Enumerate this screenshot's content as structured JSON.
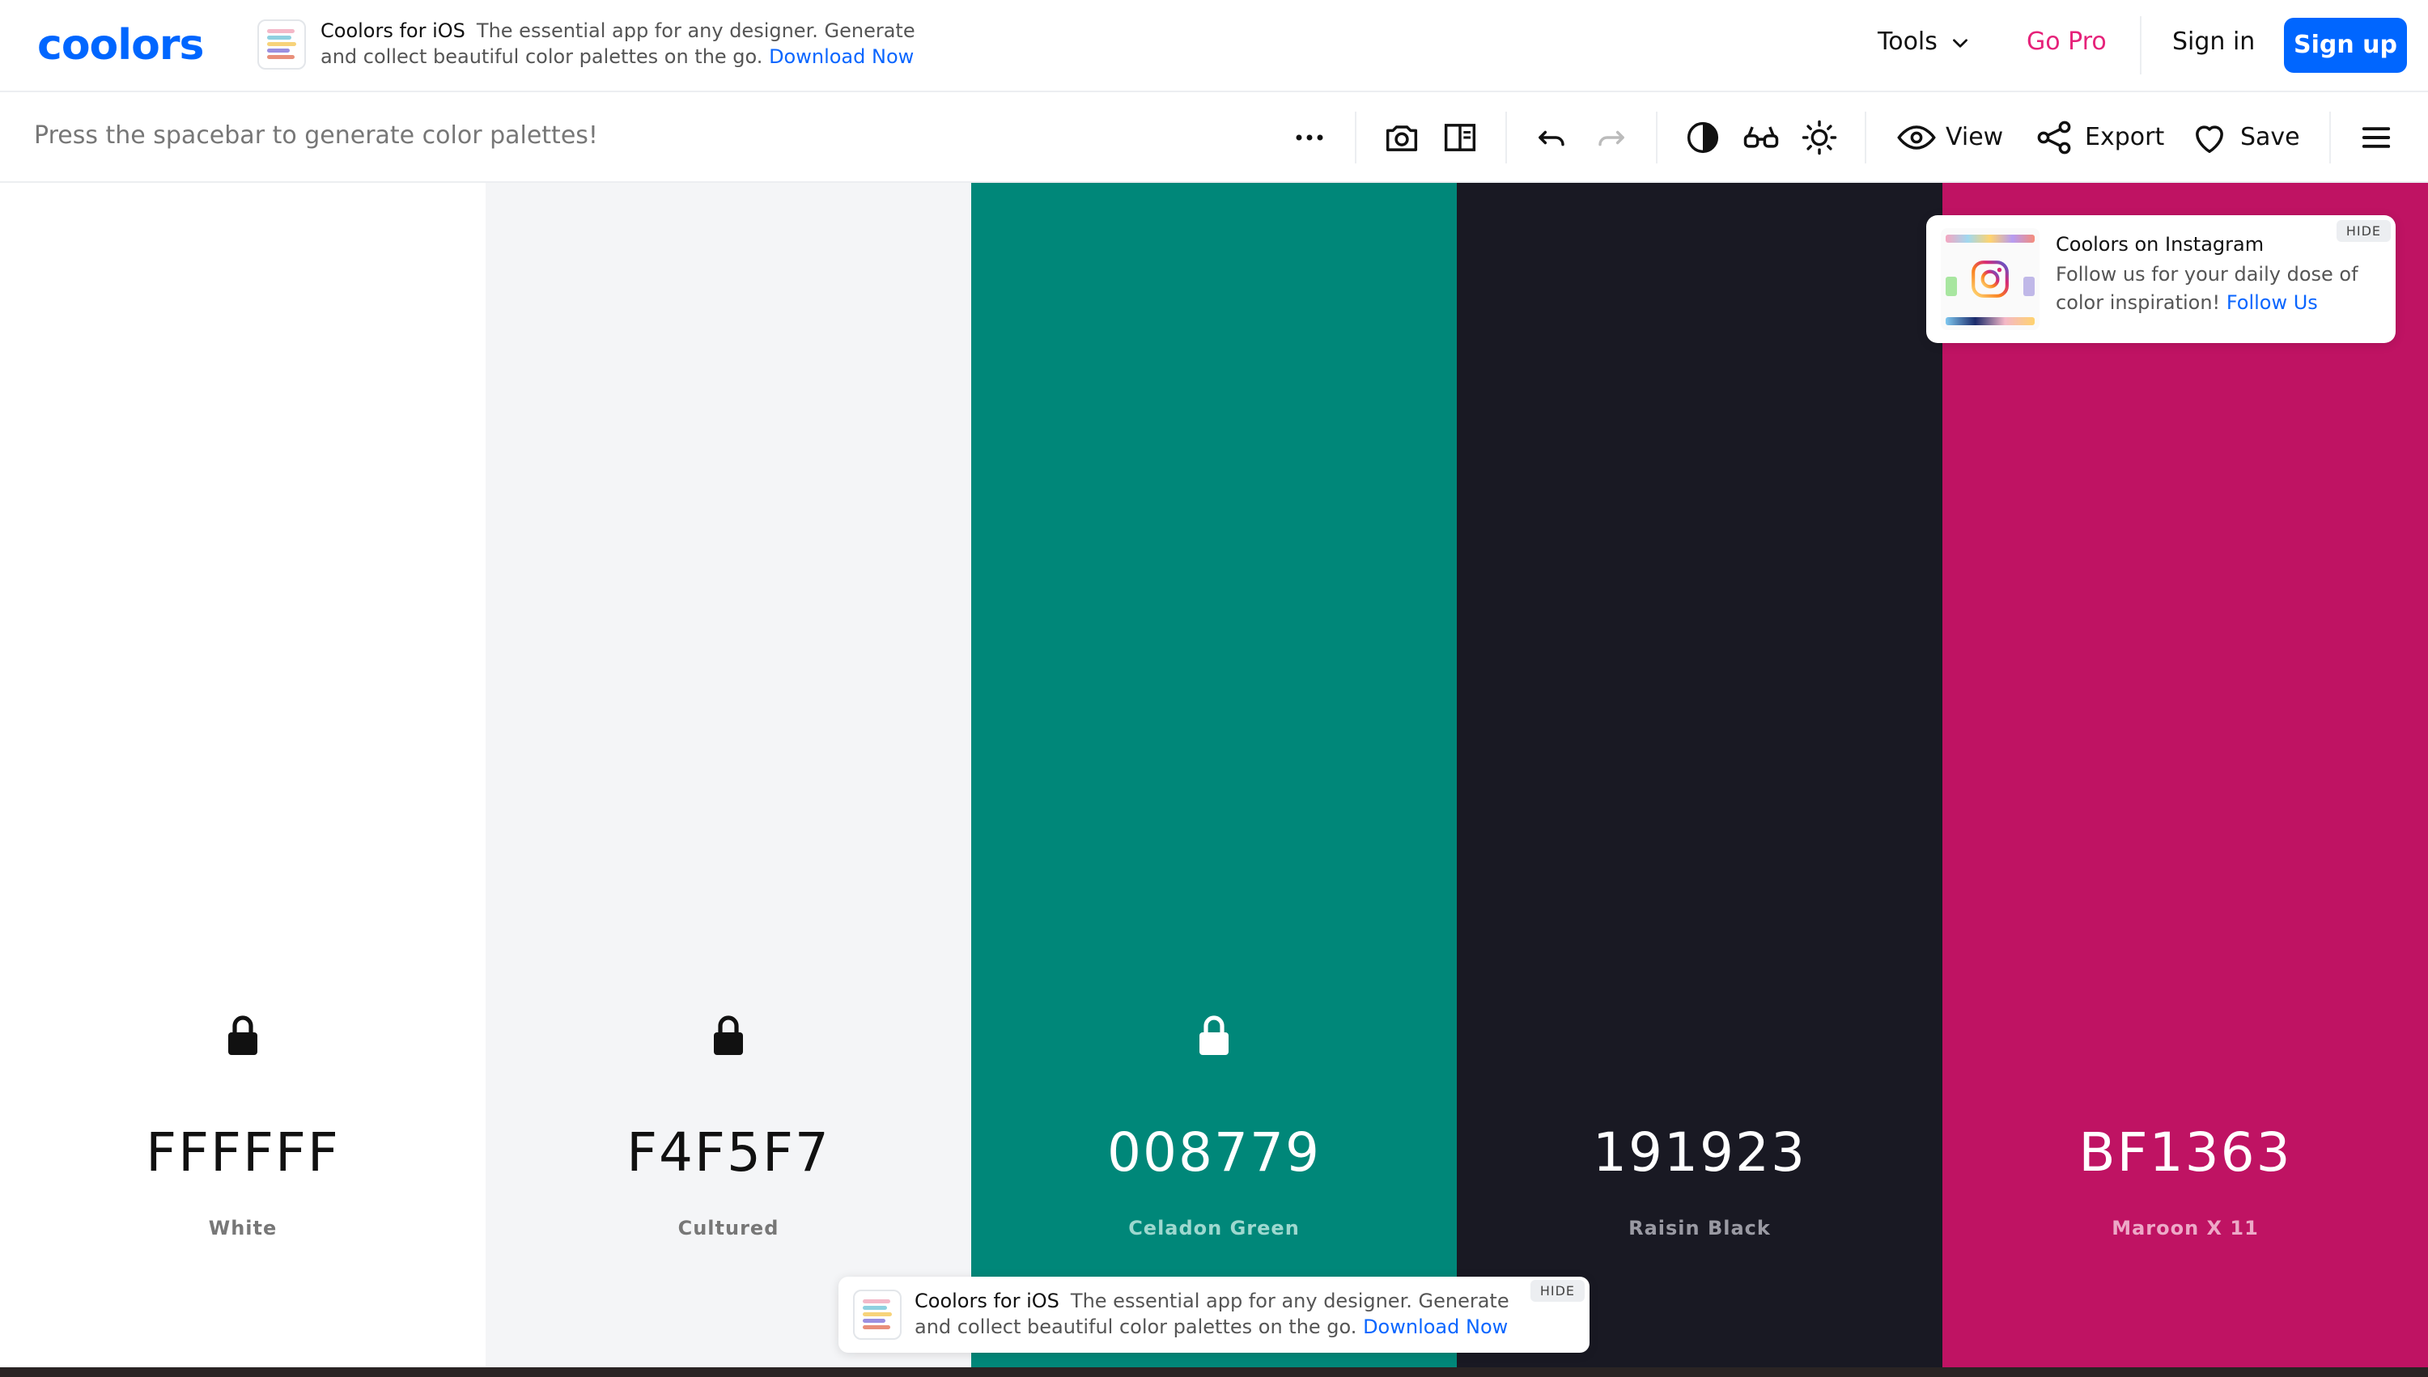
{
  "header": {
    "logo": "coolors",
    "promo": {
      "title": "Coolors for iOS",
      "text": "The essential app for any designer. Generate and collect beautiful color palettes on the go.",
      "link": "Download Now"
    },
    "nav": {
      "tools": "Tools",
      "go_pro": "Go Pro",
      "sign_in": "Sign in",
      "sign_up": "Sign up"
    }
  },
  "toolbar": {
    "hint": "Press the spacebar to generate color palettes!",
    "icons": [
      "more-icon",
      "camera-icon",
      "sidebar-icon",
      "undo-icon",
      "redo-icon",
      "contrast-icon",
      "glasses-icon",
      "brightness-icon",
      "eye-icon",
      "share-icon",
      "heart-icon",
      "menu-icon"
    ],
    "view": "View",
    "export": "Export",
    "save": "Save"
  },
  "palette": [
    {
      "hex": "FFFFFF",
      "name": "White",
      "bg": "#FFFFFF",
      "text": "#111111",
      "sub": "#777777",
      "lock": "#111111"
    },
    {
      "hex": "F4F5F7",
      "name": "Cultured",
      "bg": "#F4F5F7",
      "text": "#111111",
      "sub": "#777777",
      "lock": "#111111"
    },
    {
      "hex": "008779",
      "name": "Celadon Green",
      "bg": "#008779",
      "text": "#FFFFFF",
      "sub": "#9ED8CF",
      "lock": "#FFFFFF"
    },
    {
      "hex": "191923",
      "name": "Raisin Black",
      "bg": "#191923",
      "text": "#FFFFFF",
      "sub": "#9A9AA3",
      "lock": "#FFFFFF"
    },
    {
      "hex": "BF1363",
      "name": "Maroon X 11",
      "bg": "#BF1363",
      "text": "#FFFFFF",
      "sub": "#EDA9C7",
      "lock": "#FFFFFF"
    }
  ],
  "instagram": {
    "title": "Coolors on Instagram",
    "text": "Follow us for your daily dose of color inspiration!",
    "link": "Follow Us",
    "hide": "HIDE"
  },
  "bottom_promo": {
    "title": "Coolors for iOS",
    "text": "The essential app for any designer. Generate and collect beautiful color palettes on the go.",
    "link": "Download Now",
    "hide": "HIDE"
  },
  "colors": {
    "brand": "#0066ff",
    "gopro": "#e6227a"
  }
}
